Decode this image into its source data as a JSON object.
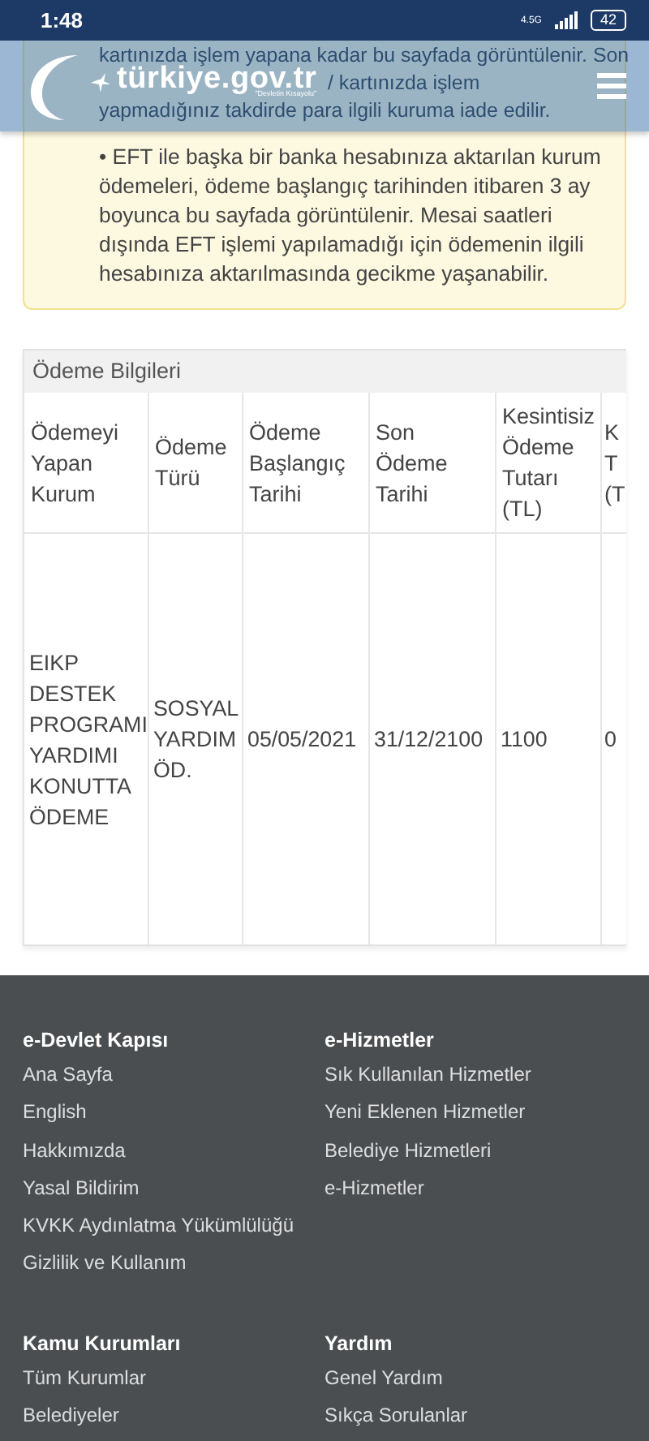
{
  "status_bar": {
    "time": "1:48",
    "network": "4.5G",
    "battery": "42"
  },
  "header": {
    "logo_text": "türkiye.gov.tr",
    "tagline": "\"Devletin Kısayolu\""
  },
  "notice": {
    "lines_behind_header": [
      {
        "text": "kartınızda işlem yapana kadar bu sayfada görüntülenir. Son",
        "indent": false
      },
      {
        "text": "/ kartınızda işlem",
        "indent": true
      },
      {
        "text": "yapmadığınız takdirde para ilgili kuruma iade edilir.",
        "indent": false
      }
    ],
    "bullet": "• EFT ile başka bir banka hesabınıza aktarılan kurum ödemeleri, ödeme başlangıç tarihinden itibaren 3 ay boyunca bu sayfada görüntülenir. Mesai saatleri dışında EFT işlemi yapılamadığı için ödemenin ilgili hesabınıza aktarılmasında gecikme yaşanabilir."
  },
  "table": {
    "title": "Ödeme Bilgileri",
    "columns": [
      "Ödemeyi Yapan Kurum",
      "Ödeme Türü",
      "Ödeme Başlangıç Tarihi",
      "Son Ödeme Tarihi",
      "Kesintisiz Ödeme Tutarı (TL)",
      "K T (T"
    ],
    "rows": [
      [
        "EIKP DESTEK PROGRAMI YARDIMI KONUTTA ÖDEME",
        "SOSYAL YARDIM ÖD.",
        "05/05/2021",
        "31/12/2100",
        "1100",
        "0"
      ]
    ]
  },
  "footer": [
    {
      "title": "e-Devlet Kapısı",
      "links": [
        "Ana Sayfa",
        "English",
        "Hakkımızda",
        "Yasal Bildirim",
        "KVKK Aydınlatma Yükümlülüğü",
        "Gizlilik ve Kullanım"
      ]
    },
    {
      "title": "e-Hizmetler",
      "links": [
        "Sık Kullanılan Hizmetler",
        "Yeni Eklenen Hizmetler",
        "Belediye Hizmetleri",
        "e-Hizmetler"
      ]
    },
    {
      "title": "Kamu Kurumları",
      "links": [
        "Tüm Kurumlar",
        "Belediyeler"
      ]
    },
    {
      "title": "Yardım",
      "links": [
        "Genel Yardım",
        "Sıkça Sorulanlar"
      ]
    }
  ]
}
